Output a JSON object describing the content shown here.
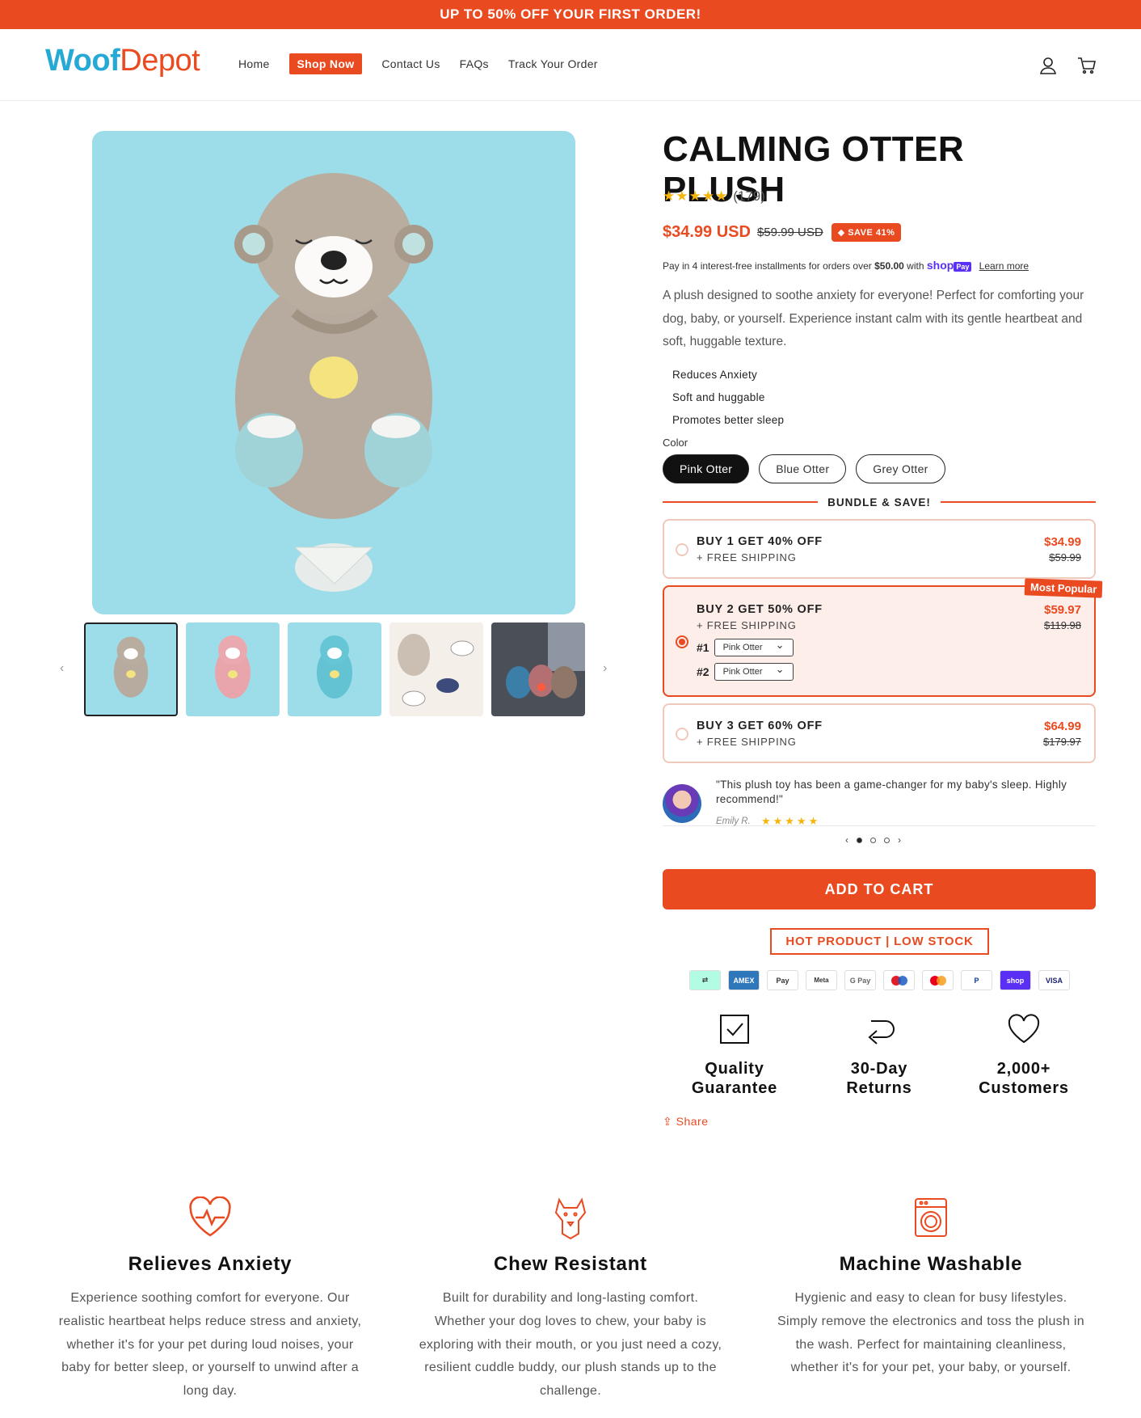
{
  "announcement": "UP TO 50% OFF YOUR FIRST ORDER!",
  "brand": {
    "part1": "Woof",
    "part2": "Depot"
  },
  "nav": {
    "home": "Home",
    "shop": "Shop Now",
    "contact": "Contact Us",
    "faqs": "FAQs",
    "track": "Track Your Order"
  },
  "product": {
    "title": "CALMING OTTER PLUSH",
    "stars": "★★★★★",
    "review_count": "(179)",
    "price": "$34.99 USD",
    "compare_price": "$59.99 USD",
    "save_badge": "SAVE 41%",
    "installments": "Pay in 4 interest-free installments for orders over",
    "installments_amount": "$50.00",
    "installments_with": "with",
    "shop_pay": "shop",
    "pay": "Pay",
    "learn_more": "Learn more",
    "description": "A plush designed to soothe anxiety for everyone!   Perfect for comforting your dog, baby, or yourself. Experience instant calm with its gentle heartbeat and soft, huggable texture.",
    "features": [
      "Reduces Anxiety",
      "Soft and huggable",
      "Promotes better sleep"
    ],
    "color_label": "Color",
    "colors": [
      "Pink Otter",
      "Blue Otter",
      "Grey Otter"
    ]
  },
  "bundle": {
    "title": "BUNDLE & SAVE!",
    "options": [
      {
        "title": "BUY 1 GET 40% OFF",
        "sub": "+ FREE SHIPPING",
        "price": "$34.99",
        "compare": "$59.99"
      },
      {
        "title": "BUY 2 GET 50% OFF",
        "sub": "+ FREE SHIPPING",
        "price": "$59.97",
        "compare": "$119.98",
        "badge": "Most Popular",
        "var1": "#1",
        "var2": "#2",
        "var_value": "Pink Otter"
      },
      {
        "title": "BUY 3 GET 60% OFF",
        "sub": "+ FREE SHIPPING",
        "price": "$64.99",
        "compare": "$179.97"
      }
    ]
  },
  "review": {
    "quote": "\"This plush toy has been a game-changer for my baby's sleep. Highly recommend!\"",
    "author": "Emily R.",
    "stars": "★★★★★"
  },
  "cta": {
    "add_to_cart": "ADD TO CART",
    "hot": "HOT PRODUCT | LOW STOCK"
  },
  "payments": [
    "afterpay",
    "AMEX",
    "Pay",
    "Meta",
    "G Pay",
    "maestro",
    "mc",
    "PayPal",
    "shop",
    "VISA"
  ],
  "guarantees": [
    {
      "line1": "Quality",
      "line2": "Guarantee"
    },
    {
      "line1": "30-Day",
      "line2": "Returns"
    },
    {
      "line1": "2,000+",
      "line2": "Customers"
    }
  ],
  "share": "Share",
  "benefits": [
    {
      "title": "Relieves Anxiety",
      "text": "Experience soothing comfort for everyone. Our realistic heartbeat helps reduce stress and anxiety, whether it's for your pet during loud noises, your baby for better sleep, or yourself to unwind after a long day."
    },
    {
      "title": "Chew Resistant",
      "text": "Built for durability and long-lasting comfort. Whether your dog loves to chew, your baby is exploring with their mouth, or you just need a cozy, resilient cuddle buddy, our plush stands up to the challenge."
    },
    {
      "title": "Machine Washable",
      "text": "Hygienic and easy to clean for busy lifestyles. Simply remove the electronics and toss the plush in the wash. Perfect for maintaining cleanliness, whether it's for your pet, your baby, or yourself."
    }
  ]
}
